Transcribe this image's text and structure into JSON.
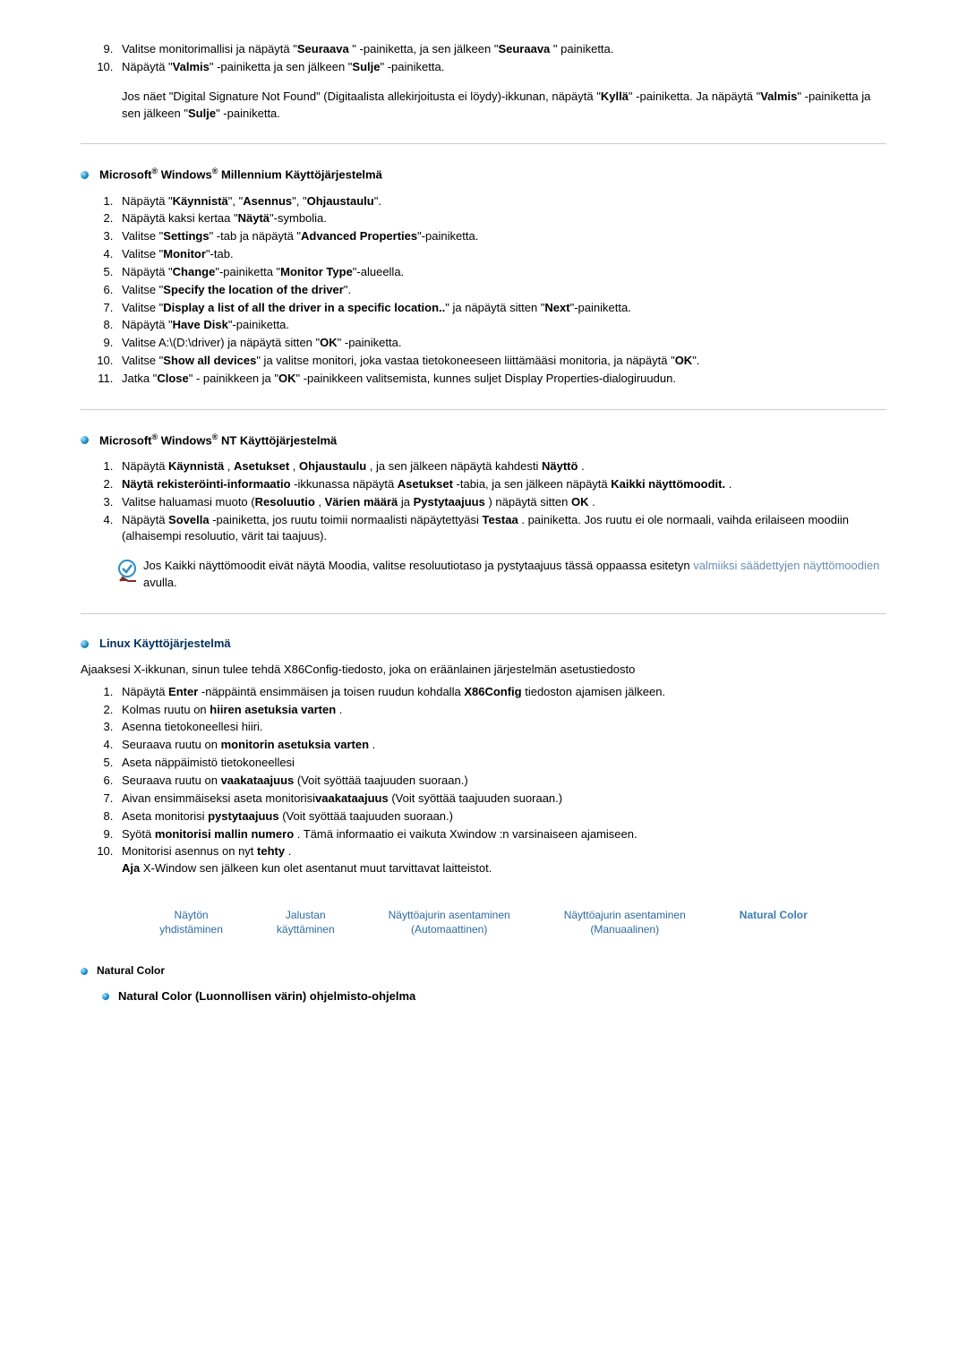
{
  "top_list_start": 9,
  "top_list": [
    "Valitse monitorimallisi ja näpäytä \"<b>Seuraava</b> \" -painiketta, ja sen jälkeen \"<b>Seuraava</b> \" painiketta.",
    "Näpäytä \"<b>Valmis</b>\" -painiketta ja sen jälkeen \"<b>Sulje</b>\" -painiketta."
  ],
  "top_after": "Jos näet \"Digital Signature Not Found\" (Digitaalista allekirjoitusta ei löydy)-ikkunan, näpäytä \"<b>Kyllä</b>\" -painiketta. Ja näpäytä \"<b>Valmis</b>\" -painiketta ja sen jälkeen \"<b>Sulje</b>\" -painiketta.",
  "section_me_title": "Microsoft<sup>®</sup> Windows<sup>®</sup> Millennium Käyttöjärjestelmä",
  "me_list": [
    "Näpäytä \"<b>Käynnistä</b>\", \"<b>Asennus</b>\", \"<b>Ohjaustaulu</b>\".",
    "Näpäytä kaksi kertaa \"<b>Näytä</b>\"-symbolia.",
    "Valitse \"<b>Settings</b>\" -tab ja näpäytä \"<b>Advanced Properties</b>\"-painiketta.",
    "Valitse \"<b>Monitor</b>\"-tab.",
    "Näpäytä \"<b>Change</b>\"-painiketta \"<b>Monitor Type</b>\"-alueella.",
    "Valitse \"<b>Specify the location of the driver</b>\".",
    "Valitse \"<b>Display a list of all the driver in a specific location..</b>\" ja näpäytä sitten \"<b>Next</b>\"-painiketta.",
    "Näpäytä \"<b>Have Disk</b>\"-painiketta.",
    "Valitse A:\\(D:\\driver) ja näpäytä sitten \"<b>OK</b>\" -painiketta.",
    "Valitse \"<b>Show all devices</b>\" ja valitse monitori, joka vastaa tietokoneeseen liittämääsi monitoria, ja näpäytä \"<b>OK</b>\".",
    "Jatka \"<b>Close</b>\" - painikkeen ja \"<b>OK</b>\" -painikkeen valitsemista, kunnes suljet Display Properties-dialogiruudun."
  ],
  "section_nt_title": "Microsoft<sup>®</sup> Windows<sup>®</sup> NT Käyttöjärjestelmä",
  "nt_list": [
    "Näpäytä <b>Käynnistä</b> , <b>Asetukset</b> , <b>Ohjaustaulu</b> , ja sen jälkeen näpäytä kahdesti <b>Näyttö</b> .",
    "<b>Näytä rekisteröinti-informaatio</b> -ikkunassa näpäytä <b>Asetukset</b> -tabia, ja sen jälkeen näpäytä <b>Kaikki näyttömoodit.</b> .",
    "Valitse haluamasi muoto (<b>Resoluutio</b> , <b>Värien määrä</b> ja <b>Pystytaajuus</b> ) näpäytä sitten <b>OK</b> .",
    "Näpäytä <b>Sovella</b> -painiketta, jos ruutu toimii normaalisti näpäytettyäsi <b>Testaa</b> . painiketta. Jos ruutu ei ole normaali, vaihda erilaiseen moodiin (alhaisempi resoluutio, värit tai taajuus)."
  ],
  "nt_note": "Jos Kaikki näyttömoodit eivät näytä Moodia, valitse resoluutiotaso ja pystytaajuus tässä oppaassa esitetyn ",
  "nt_note_link": "valmiiksi säädettyjen näyttömoodien",
  "nt_note_after": " avulla.",
  "section_linux_title": "Linux Käyttöjärjestelmä",
  "linux_intro": "Ajaaksesi X-ikkunan, sinun tulee tehdä X86Config-tiedosto, joka on eräänlainen järjestelmän asetustiedosto",
  "linux_list": [
    "Näpäytä <b>Enter</b> -näppäintä ensimmäisen ja toisen ruudun kohdalla <b>X86Config</b> tiedoston ajamisen jälkeen.",
    "Kolmas ruutu on <b>hiiren asetuksia varten</b> .",
    "Asenna tietokoneellesi hiiri.",
    "Seuraava ruutu on <b>monitorin asetuksia varten</b> .",
    "Aseta näppäimistö tietokoneellesi",
    "Seuraava ruutu on <b>vaakataajuus</b> (Voit syöttää taajuuden suoraan.)",
    "Aivan ensimmäiseksi aseta monitorisi<b>vaakataajuus</b> (Voit syöttää taajuuden suoraan.)",
    "Aseta monitorisi <b>pystytaajuus</b> (Voit syöttää taajuuden suoraan.)",
    "Syötä <b>monitorisi mallin numero</b> . Tämä informaatio ei vaikuta Xwindow :n varsinaiseen ajamiseen.",
    "Monitorisi asennus on nyt <b>tehty</b> .<br><b>Aja</b> X-Window sen jälkeen kun olet asentanut muut tarvittavat laitteistot."
  ],
  "tabs": [
    {
      "l1": "Näytön",
      "l2": "yhdistäminen"
    },
    {
      "l1": "Jalustan",
      "l2": "käyttäminen"
    },
    {
      "l1": "Näyttöajurin asentaminen",
      "l2": "(Automaattinen)"
    },
    {
      "l1": "Näyttöajurin asentaminen",
      "l2": "(Manuaalinen)"
    },
    {
      "l1": "Natural Color",
      "l2": ""
    }
  ],
  "bottom_heading": "Natural Color",
  "bottom_sub": "Natural Color (Luonnollisen värin) ohjelmisto-ohjelma"
}
